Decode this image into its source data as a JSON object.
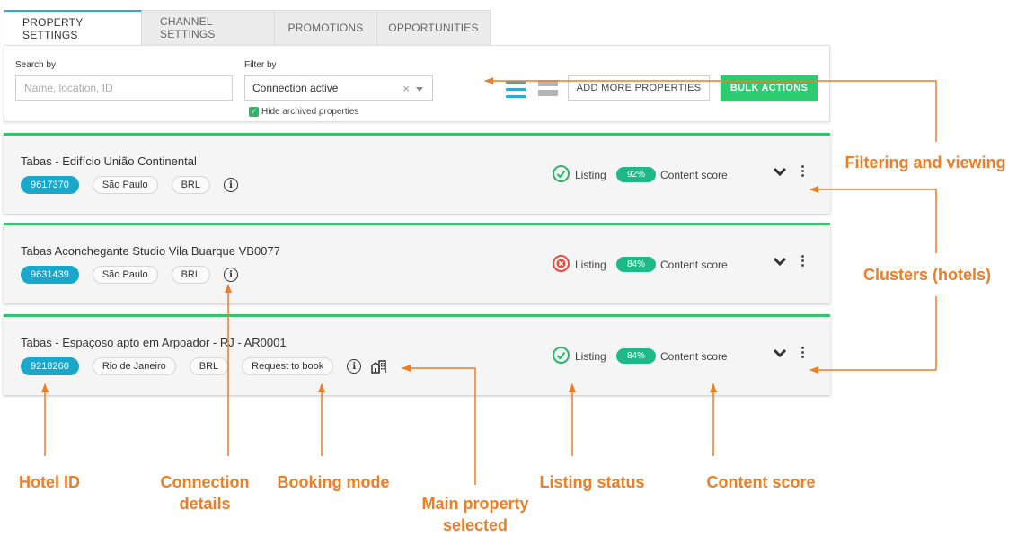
{
  "tabs": [
    {
      "label": "PROPERTY SETTINGS",
      "active": true
    },
    {
      "label": "CHANNEL SETTINGS",
      "active": false
    },
    {
      "label": "PROMOTIONS",
      "active": false
    },
    {
      "label": "OPPORTUNITIES",
      "active": false
    }
  ],
  "filters": {
    "search_label": "Search by",
    "search_placeholder": "Name, location, ID",
    "filter_label": "Filter by",
    "filter_value": "Connection active",
    "clear_glyph": "×",
    "hide_archived_label": "Hide archived properties",
    "hide_archived_checked": true,
    "add_button": "ADD MORE PROPERTIES",
    "bulk_button": "BULK ACTIONS"
  },
  "properties": [
    {
      "title": "Tabas - Edifício União Continental",
      "id": "9617370",
      "city": "São Paulo",
      "currency": "BRL",
      "listing_ok": true,
      "listing_label": "Listing",
      "score": "92%",
      "score_label": "Content score"
    },
    {
      "title": "Tabas Aconchegante Studio Vila Buarque VB0077",
      "id": "9631439",
      "city": "São Paulo",
      "currency": "BRL",
      "listing_ok": false,
      "listing_label": "Listing",
      "score": "84%",
      "score_label": "Content score"
    },
    {
      "title": "Tabas - Espaçoso apto em Arpoador - RJ - AR0001",
      "id": "9218260",
      "city": "Rio de Janeiro",
      "currency": "BRL",
      "booking_mode": "Request to book",
      "main_property": true,
      "listing_ok": true,
      "listing_label": "Listing",
      "score": "84%",
      "score_label": "Content score"
    }
  ],
  "annotations": {
    "filtering": "Filtering and viewing",
    "clusters": "Clusters (hotels)",
    "hotel_id": "Hotel ID",
    "connection_line1": "Connection",
    "connection_line2": "details",
    "booking_mode": "Booking mode",
    "main_line1": "Main property",
    "main_line2": "selected",
    "listing_status": "Listing status",
    "content_score": "Content score"
  },
  "colors": {
    "accent_green": "#2ecc71",
    "id_blue": "#1aa7cc",
    "annotation_orange": "#f07c23",
    "error_red": "#e74c3c"
  }
}
